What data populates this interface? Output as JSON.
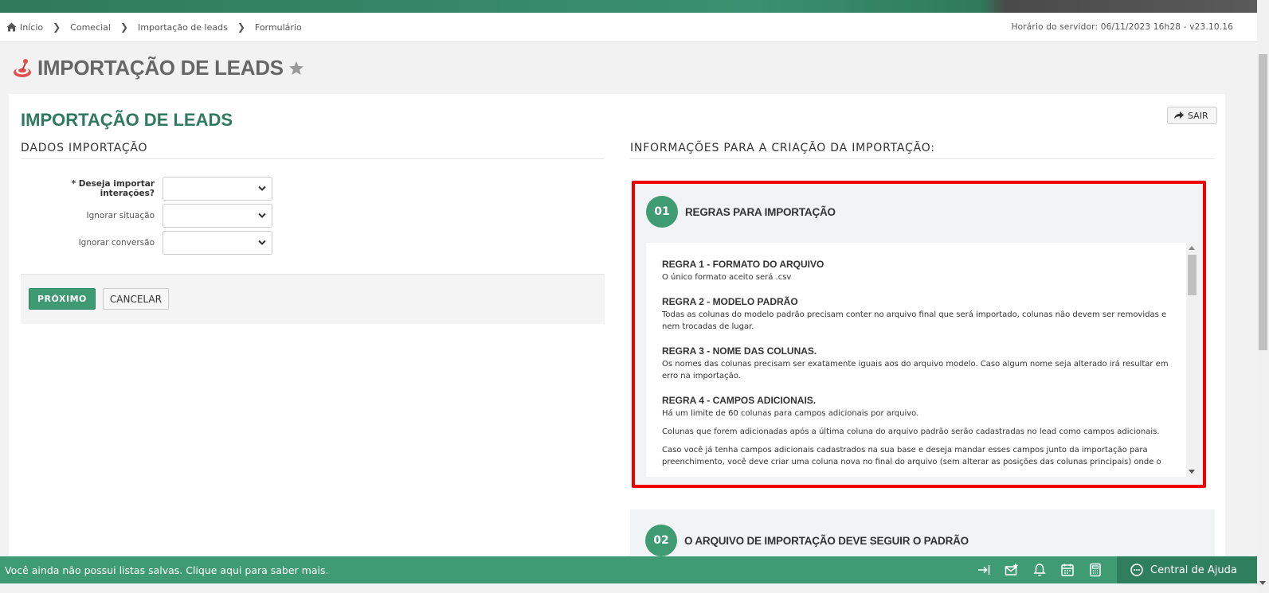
{
  "breadcrumb": {
    "items": [
      "Início",
      "Comecial",
      "Importação de leads",
      "Formulário"
    ]
  },
  "server_time": "Horário do servidor: 06/11/2023 16h28 - v23.10.16",
  "page_title": "IMPORTAÇÃO DE LEADS",
  "card": {
    "title": "IMPORTAÇÃO DE LEADS",
    "exit_label": "SAIR"
  },
  "form": {
    "section_title": "DADOS IMPORTAÇÃO",
    "fields": [
      {
        "label": "* Deseja importar interações?",
        "value": ""
      },
      {
        "label": "Ignorar situação",
        "value": ""
      },
      {
        "label": "Ignorar conversão",
        "value": ""
      }
    ],
    "next_label": "PRÓXIMO",
    "cancel_label": "CANCELAR"
  },
  "info": {
    "section_title": "INFORMAÇÕES PARA A CRIAÇÃO DA IMPORTAÇÃO:",
    "panel1": {
      "number": "01",
      "title": "REGRAS PARA IMPORTAÇÃO",
      "rules": [
        {
          "title": "REGRA 1 - FORMATO DO ARQUIVO",
          "paragraphs": [
            "O único formato aceito será .csv"
          ]
        },
        {
          "title": "REGRA 2 - MODELO PADRÃO",
          "paragraphs": [
            "Todas as colunas do modelo padrão precisam conter no arquivo final que será importado, colunas não devem ser removidas e nem trocadas de lugar."
          ]
        },
        {
          "title": "REGRA 3 - NOME DAS COLUNAS.",
          "paragraphs": [
            "Os nomes das colunas precisam ser exatamente iguais aos do arquivo modelo. Caso algum nome seja alterado irá resultar em erro na importação."
          ]
        },
        {
          "title": "REGRA 4 - CAMPOS ADICIONAIS.",
          "paragraphs": [
            "Há um limite de 60 colunas para campos adicionais por arquivo.",
            "Colunas que forem adicionadas após a última coluna do arquivo padrão serão cadastradas no lead como campos adicionais.",
            "Caso você já tenha campos adicionais cadastrados na sua base e deseja mandar esses campos junto da importação para preenchimento, você deve criar uma coluna nova no final do arquivo (sem alterar as posições das colunas principais) onde o"
          ]
        }
      ]
    },
    "panel2": {
      "number": "02",
      "title": "O ARQUIVO DE IMPORTAÇÃO DEVE SEGUIR O PADRÃO"
    }
  },
  "bottom_bar": {
    "message": "Você ainda não possui listas salvas. Clique aqui para saber mais.",
    "help_label": "Central de Ajuda"
  },
  "colors": {
    "brand_green": "#3f9b74",
    "highlight_red": "#ee0000",
    "title_green": "#2e7a5e"
  }
}
